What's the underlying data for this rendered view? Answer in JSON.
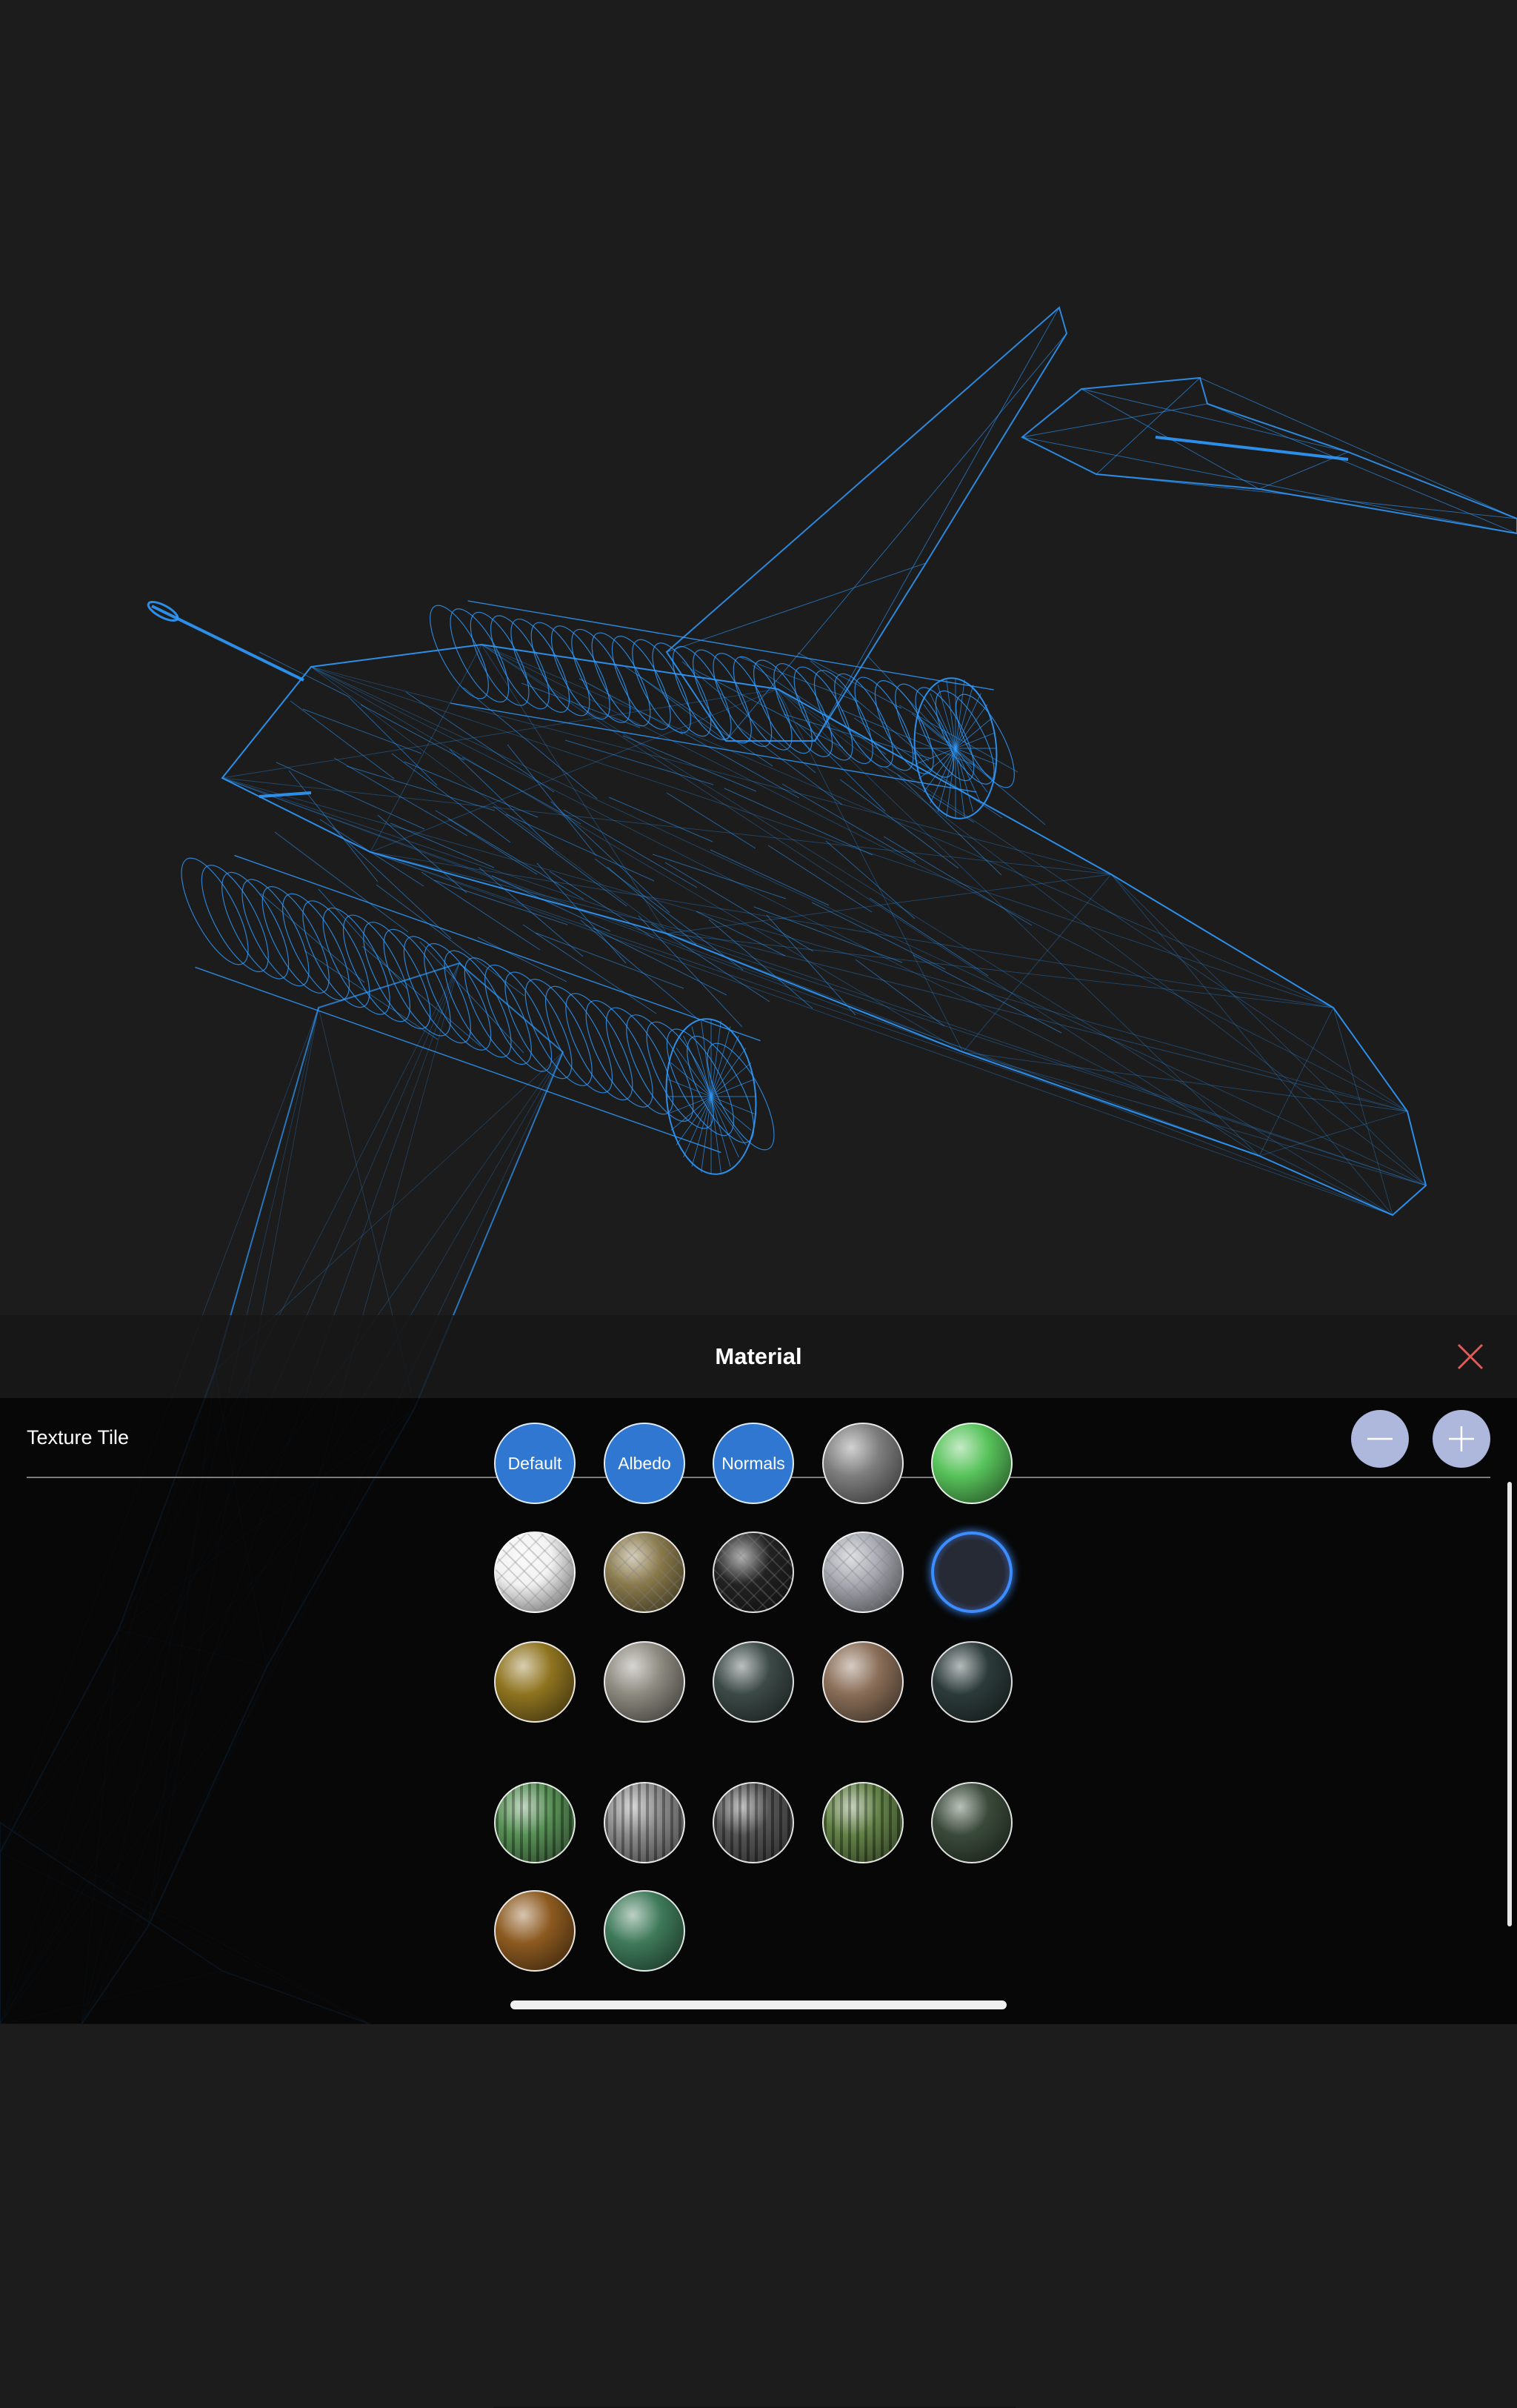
{
  "viewport": {
    "model": "wireframe-aircraft",
    "wire_color": "#2f9bff",
    "background_color": "#1c1c1c"
  },
  "panel": {
    "title": "Material",
    "close_icon": "close-icon",
    "close_color": "#e05a5a",
    "texture_tile_label": "Texture Tile",
    "decrease_icon": "minus-icon",
    "increase_icon": "plus-icon",
    "button_color": "#aeb7dc"
  },
  "materials": [
    {
      "label": "Default",
      "kind": "text"
    },
    {
      "label": "Albedo",
      "kind": "text"
    },
    {
      "label": "Normals",
      "kind": "text"
    },
    {
      "name": "grey-metal-sphere",
      "kind": "sphere",
      "color": "#7e7e7e"
    },
    {
      "name": "green-sphere",
      "kind": "sphere",
      "color": "#58c35b"
    },
    {
      "name": "white-pattern-sphere",
      "kind": "sphere",
      "color": "#f2f2f2"
    },
    {
      "name": "gold-pattern-sphere",
      "kind": "sphere",
      "color": "#8a7a4a"
    },
    {
      "name": "black-pattern-sphere",
      "kind": "sphere",
      "color": "#222222"
    },
    {
      "name": "silver-pattern-sphere",
      "kind": "sphere",
      "color": "#a6a9b1"
    },
    {
      "name": "dark-blue-glow-sphere",
      "kind": "sphere",
      "color": "#262a35",
      "selected": true
    },
    {
      "name": "gold-sphere",
      "kind": "sphere",
      "color": "#8f7420"
    },
    {
      "name": "chrome-sphere",
      "kind": "sphere",
      "color": "#8d8a80"
    },
    {
      "name": "dark-marble-sphere",
      "kind": "sphere",
      "color": "#3c4a47"
    },
    {
      "name": "wood-sphere",
      "kind": "sphere",
      "color": "#8a6e58"
    },
    {
      "name": "dark-teal-sphere",
      "kind": "sphere",
      "color": "#2c3b3a"
    },
    {
      "name": "green-striped-sphere",
      "kind": "sphere",
      "color": "#4f8a4d"
    },
    {
      "name": "grey-striped-sphere",
      "kind": "sphere",
      "color": "#858585"
    },
    {
      "name": "dark-striped-sphere",
      "kind": "sphere",
      "color": "#4a4a4a"
    },
    {
      "name": "olive-striped-sphere",
      "kind": "sphere",
      "color": "#5a7a3d"
    },
    {
      "name": "dark-green-sphere",
      "kind": "sphere",
      "color": "#3a4a3a"
    },
    {
      "name": "rust-sphere",
      "kind": "sphere",
      "color": "#8c5a20"
    },
    {
      "name": "green-stone-sphere",
      "kind": "sphere",
      "color": "#3f7a5a"
    }
  ]
}
